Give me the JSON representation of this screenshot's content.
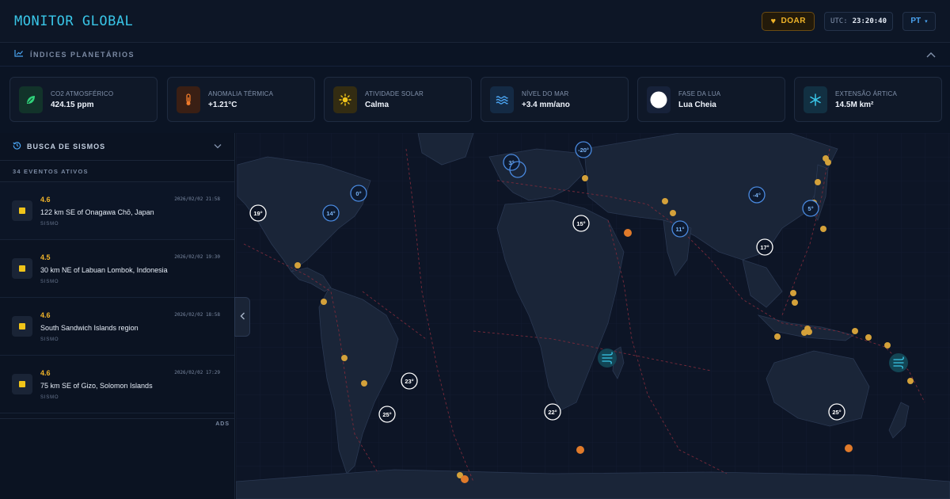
{
  "header": {
    "logo": "MONITOR GLOBAL",
    "donate_label": "DOAR",
    "utc_label": "UTC:",
    "utc_time": "23:20:40",
    "language": "PT"
  },
  "indices": {
    "title": "ÍNDICES PLANETÁRIOS",
    "cards": [
      {
        "label": "CO2 ATMOSFÉRICO",
        "value": "424.15 ppm",
        "icon": "leaf-icon",
        "color": "#2fd27a"
      },
      {
        "label": "ANOMALIA TÉRMICA",
        "value": "+1.21°C",
        "icon": "thermometer-icon",
        "color": "#f07a2a"
      },
      {
        "label": "ATIVIDADE SOLAR",
        "value": "Calma",
        "icon": "sun-icon",
        "color": "#f0c419"
      },
      {
        "label": "NÍVEL DO MAR",
        "value": "+3.4 mm/ano",
        "icon": "waves-icon",
        "color": "#4aa3f0"
      },
      {
        "label": "FASE DA LUA",
        "value": "Lua Cheia",
        "icon": "moon-icon",
        "color": "#ffffff"
      },
      {
        "label": "EXTENSÃO ÁRTICA",
        "value": "14.5M km²",
        "icon": "snowflake-icon",
        "color": "#39c6e8"
      }
    ]
  },
  "sidebar": {
    "title": "BUSCA DE SISMOS",
    "count": "34 EVENTOS ATIVOS",
    "ads": "ADS",
    "events": [
      {
        "mag": "4.6",
        "date": "2026/02/02 21:58",
        "place": "122 km SE of Onagawa Chō, Japan",
        "type": "SISMO"
      },
      {
        "mag": "4.5",
        "date": "2026/02/02 19:30",
        "place": "30 km NE of Labuan Lombok, Indonesia",
        "type": "SISMO"
      },
      {
        "mag": "4.6",
        "date": "2026/02/02 18:58",
        "place": "South Sandwich Islands region",
        "type": "SISMO"
      },
      {
        "mag": "4.6",
        "date": "2026/02/02 17:29",
        "place": "75 km SE of Gizo, Solomon Islands",
        "type": "SISMO"
      }
    ]
  },
  "map": {
    "temps_cold": [
      "3°",
      "-20°",
      "0°",
      "14°",
      "-4°",
      "5°",
      "11°"
    ],
    "temps_warm": [
      "19°",
      "15°",
      "17°",
      "23°",
      "25°",
      "22°",
      "25°"
    ],
    "storm_icon": "cyclone-icon"
  }
}
